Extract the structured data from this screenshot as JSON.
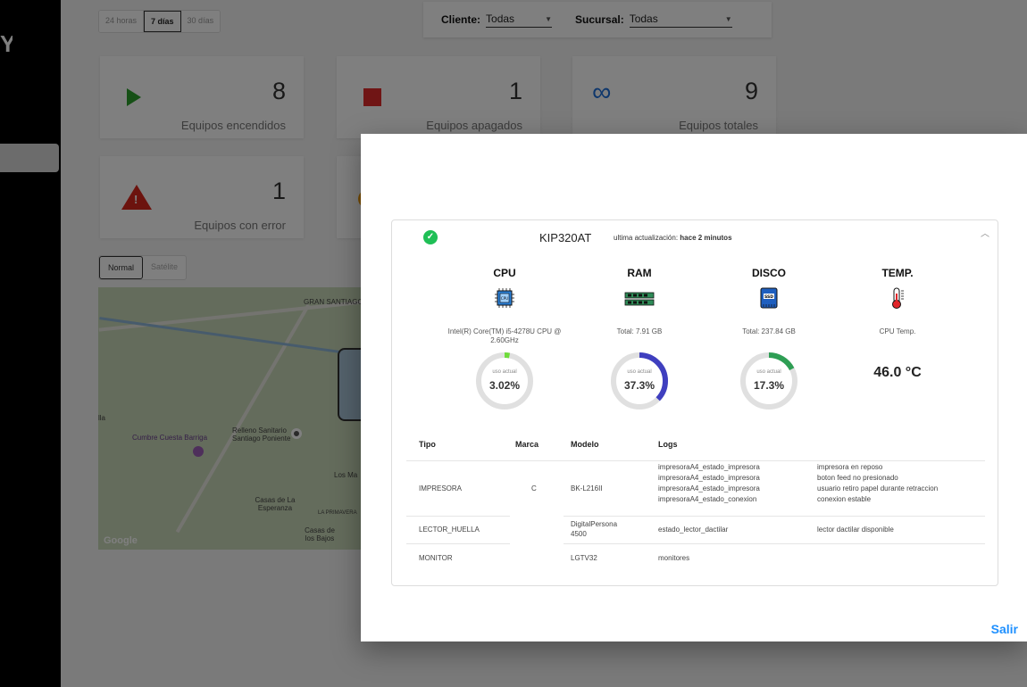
{
  "sidebar": {
    "brand": "Y"
  },
  "ranges": [
    "24 horas",
    "7 días",
    "30 días"
  ],
  "filters": {
    "cliente_label": "Cliente:",
    "cliente_value": "Todas",
    "sucursal_label": "Sucursal:",
    "sucursal_value": "Todas"
  },
  "stats": {
    "encendidos": {
      "value": "8",
      "label": "Equipos encendidos"
    },
    "apagados": {
      "value": "1",
      "label": "Equipos apagados"
    },
    "totales": {
      "value": "9",
      "label": "Equipos totales"
    },
    "error": {
      "value": "1",
      "label": "Equipos con error"
    }
  },
  "map_types": [
    "Normal",
    "Satélite"
  ],
  "map": {
    "labels": [
      "GRAN SANTIAGO",
      "Relleno Sanitario Santiago Poniente",
      "Cumbre Cuesta Barriga",
      "Casas de La Esperanza",
      "Los Ma",
      "LA PRIMAVERA",
      "Casas de los Bajos",
      "lla",
      "Google"
    ]
  },
  "modal": {
    "device": "KIP320AT",
    "update_prefix": "ultima actualización:",
    "update_value": "hace 2 minutos",
    "exit": "Salir",
    "metrics": {
      "cpu": {
        "title": "CPU",
        "desc": "Intel(R) Core(TM) i5-4278U CPU @ 2.60GHz",
        "gauge_label": "uso actual",
        "value": "3.02%",
        "percent": 3.02,
        "color": "#6fdc3c"
      },
      "ram": {
        "title": "RAM",
        "desc": "Total: 7.91 GB",
        "gauge_label": "uso actual",
        "value": "37.3%",
        "percent": 37.3,
        "color": "#3f3fbf"
      },
      "disco": {
        "title": "DISCO",
        "desc": "Total: 237.84 GB",
        "gauge_label": "uso actual",
        "value": "17.3%",
        "percent": 17.3,
        "color": "#2e9e54"
      },
      "temp": {
        "title": "TEMP.",
        "desc": "CPU Temp.",
        "value": "46.0 °C"
      }
    },
    "table": {
      "headers": {
        "tipo": "Tipo",
        "marca": "Marca",
        "modelo": "Modelo",
        "logs": "Logs"
      },
      "rows": [
        {
          "tipo": "IMPRESORA",
          "marca": "C",
          "modelo": "BK-L216II",
          "logs": [
            {
              "key": "impresoraA4_estado_impresora",
              "value": "impresora en reposo"
            },
            {
              "key": "impresoraA4_estado_impresora",
              "value": "boton feed no presionado"
            },
            {
              "key": "impresoraA4_estado_impresora",
              "value": "usuario retiro papel durante retraccion"
            },
            {
              "key": "impresoraA4_estado_conexion",
              "value": "conexion estable"
            }
          ]
        },
        {
          "tipo": "LECTOR_HUELLA",
          "marca": "",
          "modelo": "DigitalPersona 4500",
          "logs": [
            {
              "key": "estado_lector_dactilar",
              "value": "lector dactilar disponible"
            }
          ]
        },
        {
          "tipo": "MONITOR",
          "marca": "",
          "modelo": "LGTV32",
          "logs": [
            {
              "key": "monitores",
              "value": ""
            }
          ]
        }
      ]
    }
  }
}
